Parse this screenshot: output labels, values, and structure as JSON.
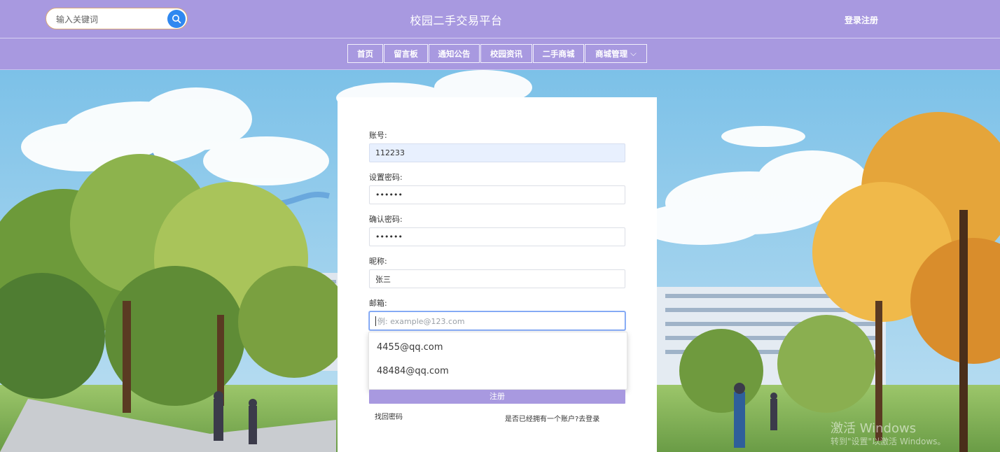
{
  "header": {
    "search_placeholder": "输入关键词",
    "site_title": "校园二手交易平台",
    "login_register": "登录注册"
  },
  "nav": {
    "items": [
      "首页",
      "留言板",
      "通知公告",
      "校园资讯",
      "二手商城",
      "商城管理"
    ]
  },
  "form": {
    "account_label": "账号:",
    "account_value": "112233",
    "password_label": "设置密码:",
    "password_value": "••••••",
    "confirm_label": "确认密码:",
    "confirm_value": "••••••",
    "nickname_label": "昵称:",
    "nickname_value": "张三",
    "email_label": "邮箱:",
    "email_placeholder": "例: example@123.com",
    "email_suggestions": [
      "4455@qq.com",
      "48484@qq.com"
    ],
    "register_button": "注册",
    "forgot_password": "找回密码",
    "have_account": "是否已经拥有一个账户?去登录"
  },
  "watermark": {
    "line1": "激活 Windows",
    "line2": "转到\"设置\"以激活 Windows。"
  },
  "colors": {
    "header_bg": "#a899e0",
    "search_button": "#2f88f0",
    "register_button": "#a899e0"
  }
}
